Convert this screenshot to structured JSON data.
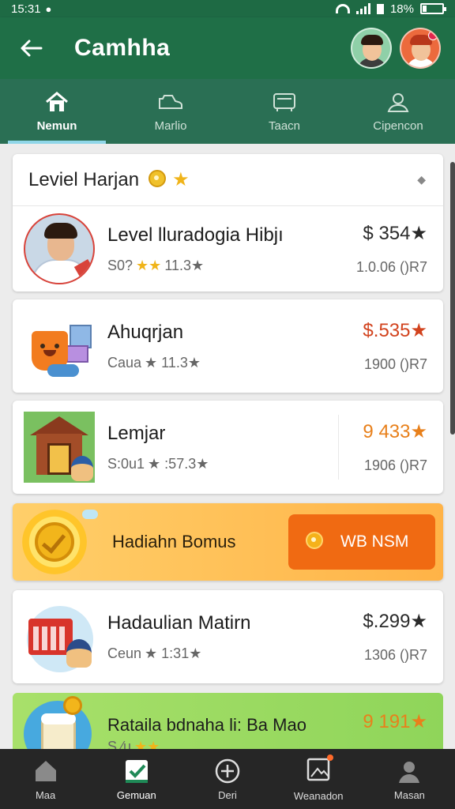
{
  "status_bar": {
    "time": "15:31",
    "battery": "18%"
  },
  "app_bar": {
    "title": "Camhha"
  },
  "tabs": [
    {
      "label": "Nemun",
      "icon": "home-icon",
      "active": true
    },
    {
      "label": "Marlio",
      "icon": "shoe-icon",
      "active": false
    },
    {
      "label": "Taacn",
      "icon": "box-icon",
      "active": false
    },
    {
      "label": "Cipencon",
      "icon": "person-icon",
      "active": false
    }
  ],
  "header_card": {
    "title": "Leviel Harjan",
    "item": {
      "title": "Level lluradogia Hibjı",
      "sub_prefix": "S0?",
      "stars_gold": "★★",
      "rating": "11.3★",
      "price": "$ 354★",
      "meta": "1.0.06 ()R7"
    }
  },
  "items": [
    {
      "title": "Ahuqrjan",
      "sub_prefix": "Caua",
      "rating": "★ 11.3★",
      "price": "$.535★",
      "meta": "1900 ()R7",
      "price_color": "red"
    },
    {
      "title": "Lemjar",
      "sub_prefix": "S:0u1",
      "rating": "★ :57.3★",
      "price": "9 433★",
      "meta": "1906 ()R7",
      "price_color": "orange"
    }
  ],
  "bonus": {
    "label": "Hadiahn Bomus",
    "button_label": "WB NSM"
  },
  "item4": {
    "title": "Hadaulian Matirn",
    "sub_prefix": "Ceun",
    "rating": "★ 1:31★",
    "price": "$.299★",
    "meta": "1306 ()R7"
  },
  "item5": {
    "title": "Rataila bdnaha li: Ba Mao",
    "sub_prefix": "S ⁄u",
    "rating": "★★",
    "price": "9 191★"
  },
  "bottom_nav": [
    {
      "label": "Maa",
      "icon": "house-icon"
    },
    {
      "label": "Gemuan",
      "icon": "check-icon",
      "active": true
    },
    {
      "label": "Deri",
      "icon": "plus-circle-icon"
    },
    {
      "label": "Weanadon",
      "icon": "image-icon"
    },
    {
      "label": "Masan",
      "icon": "user-icon"
    }
  ]
}
